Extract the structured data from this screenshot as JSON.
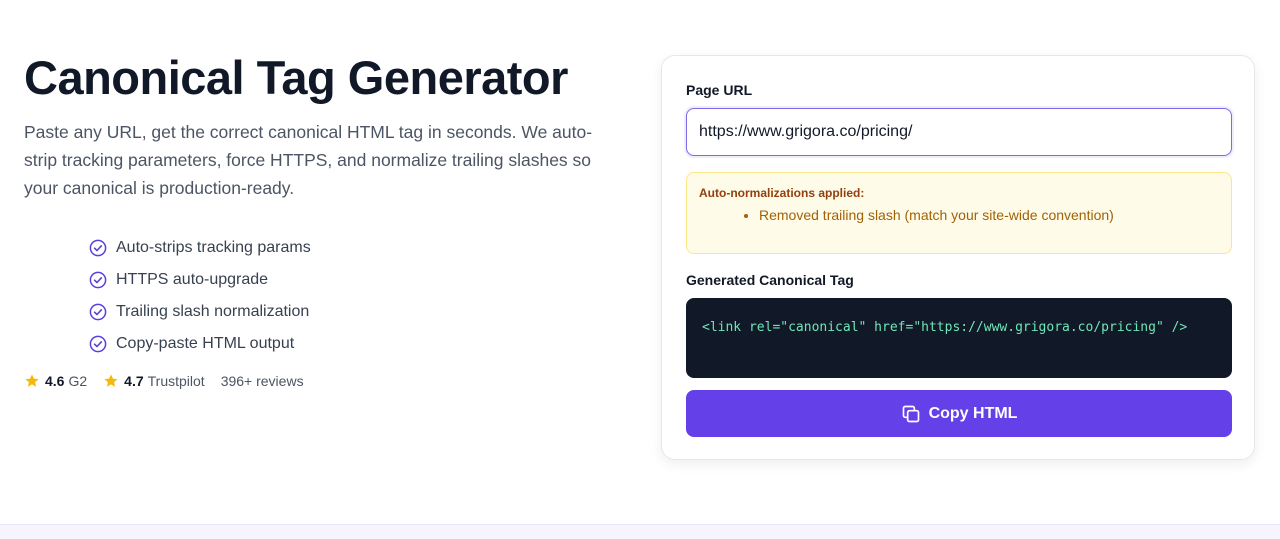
{
  "hero": {
    "title": "Canonical Tag Generator",
    "subtitle": "Paste any URL, get the correct canonical HTML tag in seconds. We auto-strip tracking parameters, force HTTPS, and normalize trailing slashes so your canonical is production-ready.",
    "features": [
      "Auto-strips tracking params",
      "HTTPS auto-upgrade",
      "Trailing slash normalization",
      "Copy-paste HTML output"
    ],
    "ratings": [
      {
        "score": "4.6",
        "source": "G2"
      },
      {
        "score": "4.7",
        "source": "Trustpilot"
      }
    ],
    "reviews": "396+ reviews"
  },
  "tool": {
    "url_label": "Page URL",
    "url_value": "https://www.grigora.co/pricing/",
    "notice_title": "Auto-normalizations applied:",
    "notice_items": [
      "Removed trailing slash (match your site-wide convention)"
    ],
    "output_label": "Generated Canonical Tag",
    "output_code": "<link rel=\"canonical\" href=\"https://www.grigora.co/pricing\" />",
    "copy_label": "Copy HTML"
  },
  "icons": {
    "feature": "check-circle-icon",
    "rating": "star-icon",
    "copy": "copy-icon"
  },
  "colors": {
    "accent": "#6340e8",
    "check": "#5b3fd6",
    "star": "#f5b80b",
    "notice_bg": "#fefbe8",
    "notice_text": "#a16207",
    "code_bg": "#111827",
    "code_text": "#6ee7b7"
  }
}
